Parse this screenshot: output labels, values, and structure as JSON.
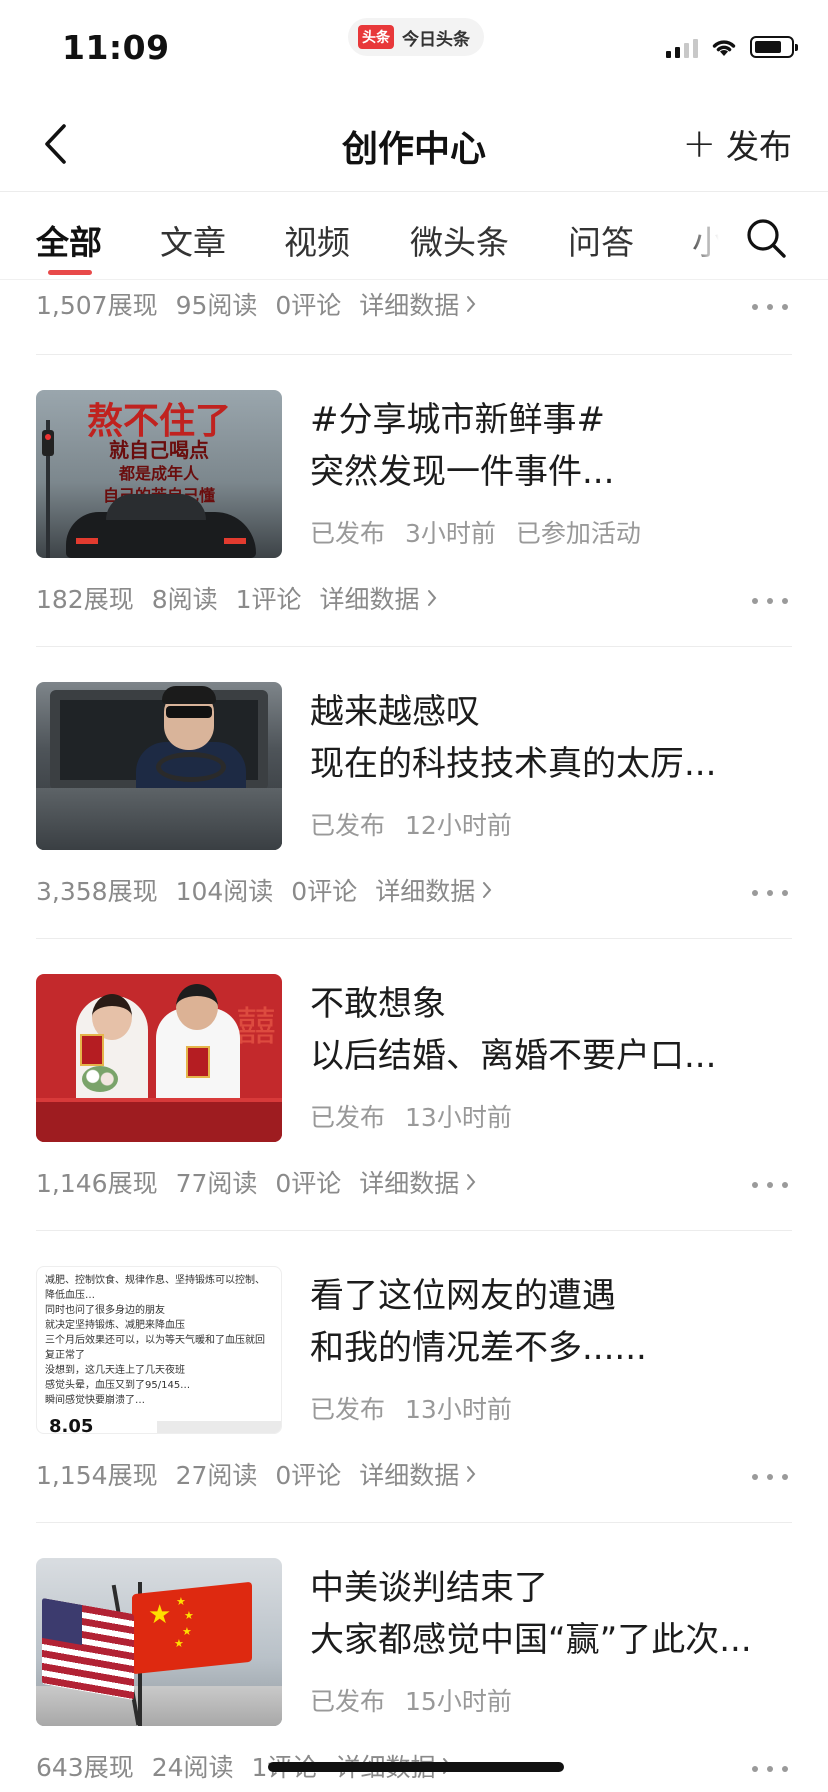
{
  "status_bar": {
    "time": "11:09",
    "app_badge": "头条",
    "app_name": "今日头条"
  },
  "nav": {
    "title": "创作中心",
    "publish_label": "发布"
  },
  "tabs": [
    "全部",
    "文章",
    "视频",
    "微头条",
    "问答",
    "小"
  ],
  "active_tab": "全部",
  "top_stats": {
    "views": "1,507展现",
    "reads": "95阅读",
    "comments": "0评论",
    "detail": "详细数据"
  },
  "items": [
    {
      "thumb_lines": [
        "熬不住了",
        "就自己喝点",
        "都是成年人",
        "自己的苦自己懂"
      ],
      "title1": "#分享城市新鲜事#",
      "title2": "突然发现一件事件...",
      "status": "已发布",
      "time": "3小时前",
      "tag": "已参加活动",
      "views": "182展现",
      "reads": "8阅读",
      "comments": "1评论",
      "detail": "详细数据"
    },
    {
      "title1": "越来越感叹",
      "title2": "现在的科技技术真的太厉...",
      "status": "已发布",
      "time": "12小时前",
      "views": "3,358展现",
      "reads": "104阅读",
      "comments": "0评论",
      "detail": "详细数据"
    },
    {
      "title1": "不敢想象",
      "title2": "以后结婚、离婚不要户口...",
      "status": "已发布",
      "time": "13小时前",
      "views": "1,146展现",
      "reads": "77阅读",
      "comments": "0评论",
      "detail": "详细数据"
    },
    {
      "thumb_lines": [
        "减肥、控制饮食、规律作息、坚持锻炼可以控制、",
        "降低血压…",
        "同时也问了很多身边的朋友",
        "就决定坚持锻炼、减肥来降血压",
        "三个月后效果还可以，以为等天气暖和了血压就回",
        "复正常了",
        "没想到，这几天连上了几天夜班",
        "感觉头晕，血压又到了95/145…",
        "瞬间感觉快要崩溃了…"
      ],
      "thumb_footer": "8.05",
      "title1": "看了这位网友的遭遇",
      "title2": "和我的情况差不多......",
      "status": "已发布",
      "time": "13小时前",
      "views": "1,154展现",
      "reads": "27阅读",
      "comments": "0评论",
      "detail": "详细数据"
    },
    {
      "title1": "中美谈判结束了",
      "title2": "大家都感觉中国“赢”了此次...",
      "status": "已发布",
      "time": "15小时前",
      "views": "643展现",
      "reads": "24阅读",
      "comments": "1评论",
      "detail": "详细数据"
    }
  ]
}
